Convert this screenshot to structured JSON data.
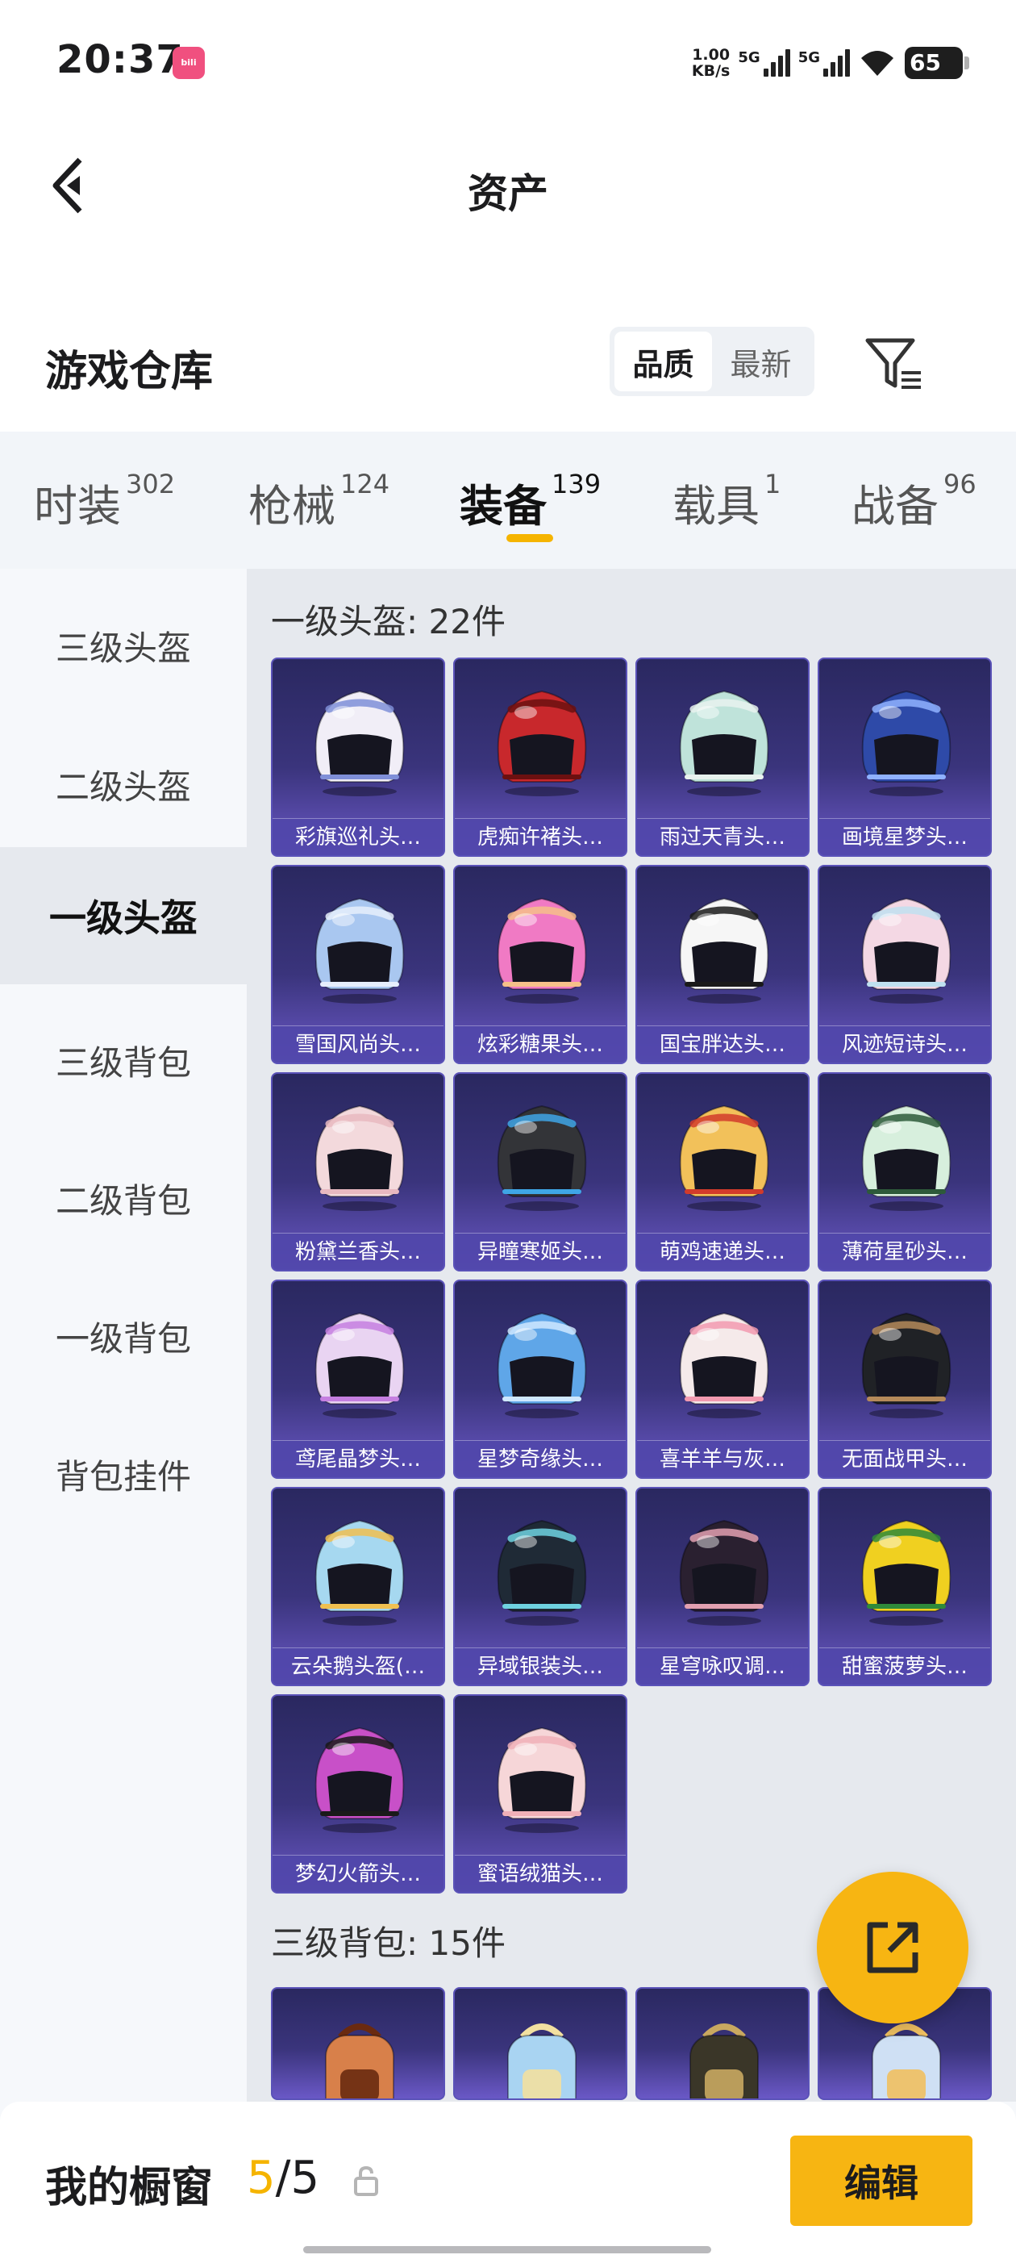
{
  "status_bar": {
    "time": "20:37",
    "app_badge": "bilibili",
    "speed_value": "1.00",
    "speed_unit": "KB/s",
    "signal_1": "5G",
    "signal_2": "5G",
    "battery": "65"
  },
  "header": {
    "title": "资产",
    "back_icon": "chevron-left-icon"
  },
  "warehouse": {
    "title": "游戏仓库",
    "sort_options": [
      "品质",
      "最新"
    ],
    "sort_selected": "品质",
    "filter_icon": "filter-icon"
  },
  "category_tabs": [
    {
      "label": "时装",
      "count": "302"
    },
    {
      "label": "枪械",
      "count": "124"
    },
    {
      "label": "装备",
      "count": "139",
      "active": true
    },
    {
      "label": "载具",
      "count": "1"
    },
    {
      "label": "战备",
      "count": "96"
    }
  ],
  "sidebar": {
    "items": [
      "三级头盔",
      "二级头盔",
      "一级头盔",
      "三级背包",
      "二级背包",
      "一级背包",
      "背包挂件"
    ],
    "active": "一级头盔"
  },
  "groups": [
    {
      "title": "一级头盔: 22件",
      "items": [
        {
          "label": "彩旗巡礼头…",
          "color": "#f1eef7",
          "accent": "#7f8fd8"
        },
        {
          "label": "虎痴许褚头…",
          "color": "#c8282c",
          "accent": "#6b1010"
        },
        {
          "label": "雨过天青头…",
          "color": "#bfe3da",
          "accent": "#e8f2ee"
        },
        {
          "label": "画境星梦头…",
          "color": "#2e4aa8",
          "accent": "#8fb1ff"
        },
        {
          "label": "雪国风尚头…",
          "color": "#a9c7f0",
          "accent": "#e6eefc"
        },
        {
          "label": "炫彩糖果头…",
          "color": "#f07ac4",
          "accent": "#f6c089"
        },
        {
          "label": "国宝胖达头…",
          "color": "#f6f6f6",
          "accent": "#1a1a1a"
        },
        {
          "label": "风迹短诗头…",
          "color": "#f4d8e4",
          "accent": "#bfe0f0"
        },
        {
          "label": "粉黛兰香头…",
          "color": "#f3d9dc",
          "accent": "#e8b8c0"
        },
        {
          "label": "异瞳寒姬头…",
          "color": "#333438",
          "accent": "#3fa6e6"
        },
        {
          "label": "萌鸡速递头…",
          "color": "#f2c15a",
          "accent": "#d23b2b"
        },
        {
          "label": "薄荷星砂头…",
          "color": "#d7efdd",
          "accent": "#2d5a3a"
        },
        {
          "label": "鸢尾晶梦头…",
          "color": "#e9d4f2",
          "accent": "#c57fe0"
        },
        {
          "label": "星梦奇缘头…",
          "color": "#5fa6e8",
          "accent": "#cfe8ff"
        },
        {
          "label": "喜羊羊与灰…",
          "color": "#f5eaea",
          "accent": "#f29ab0"
        },
        {
          "label": "无面战甲头…",
          "color": "#202226",
          "accent": "#b58a5a"
        },
        {
          "label": "云朵鹅头盔(…",
          "color": "#a6d8f0",
          "accent": "#f0c050"
        },
        {
          "label": "异域银装头…",
          "color": "#1f2a36",
          "accent": "#6fd2e0"
        },
        {
          "label": "星穹咏叹调…",
          "color": "#2a2030",
          "accent": "#e2a0b0"
        },
        {
          "label": "甜蜜菠萝头…",
          "color": "#f0d020",
          "accent": "#2f8a3a"
        },
        {
          "label": "梦幻火箭头…",
          "color": "#c850c8",
          "accent": "#1a1a1a"
        },
        {
          "label": "蜜语绒猫头…",
          "color": "#f6d6d8",
          "accent": "#f0b0b8"
        }
      ]
    },
    {
      "title": "三级背包: 15件",
      "items": [
        {
          "label": "",
          "color": "#d8804a",
          "accent": "#6a2a10"
        },
        {
          "label": "",
          "color": "#a9d4f2",
          "accent": "#f2e0a0"
        },
        {
          "label": "",
          "color": "#3a3628",
          "accent": "#c9a860"
        },
        {
          "label": "",
          "color": "#cfe0f4",
          "accent": "#f0c060"
        }
      ]
    }
  ],
  "fab": {
    "icon": "share-external-icon"
  },
  "bottom_bar": {
    "title": "我的橱窗",
    "count_current": "5",
    "count_sep": "/",
    "count_total": "5",
    "lock_icon": "lock-icon",
    "edit_label": "编辑"
  }
}
